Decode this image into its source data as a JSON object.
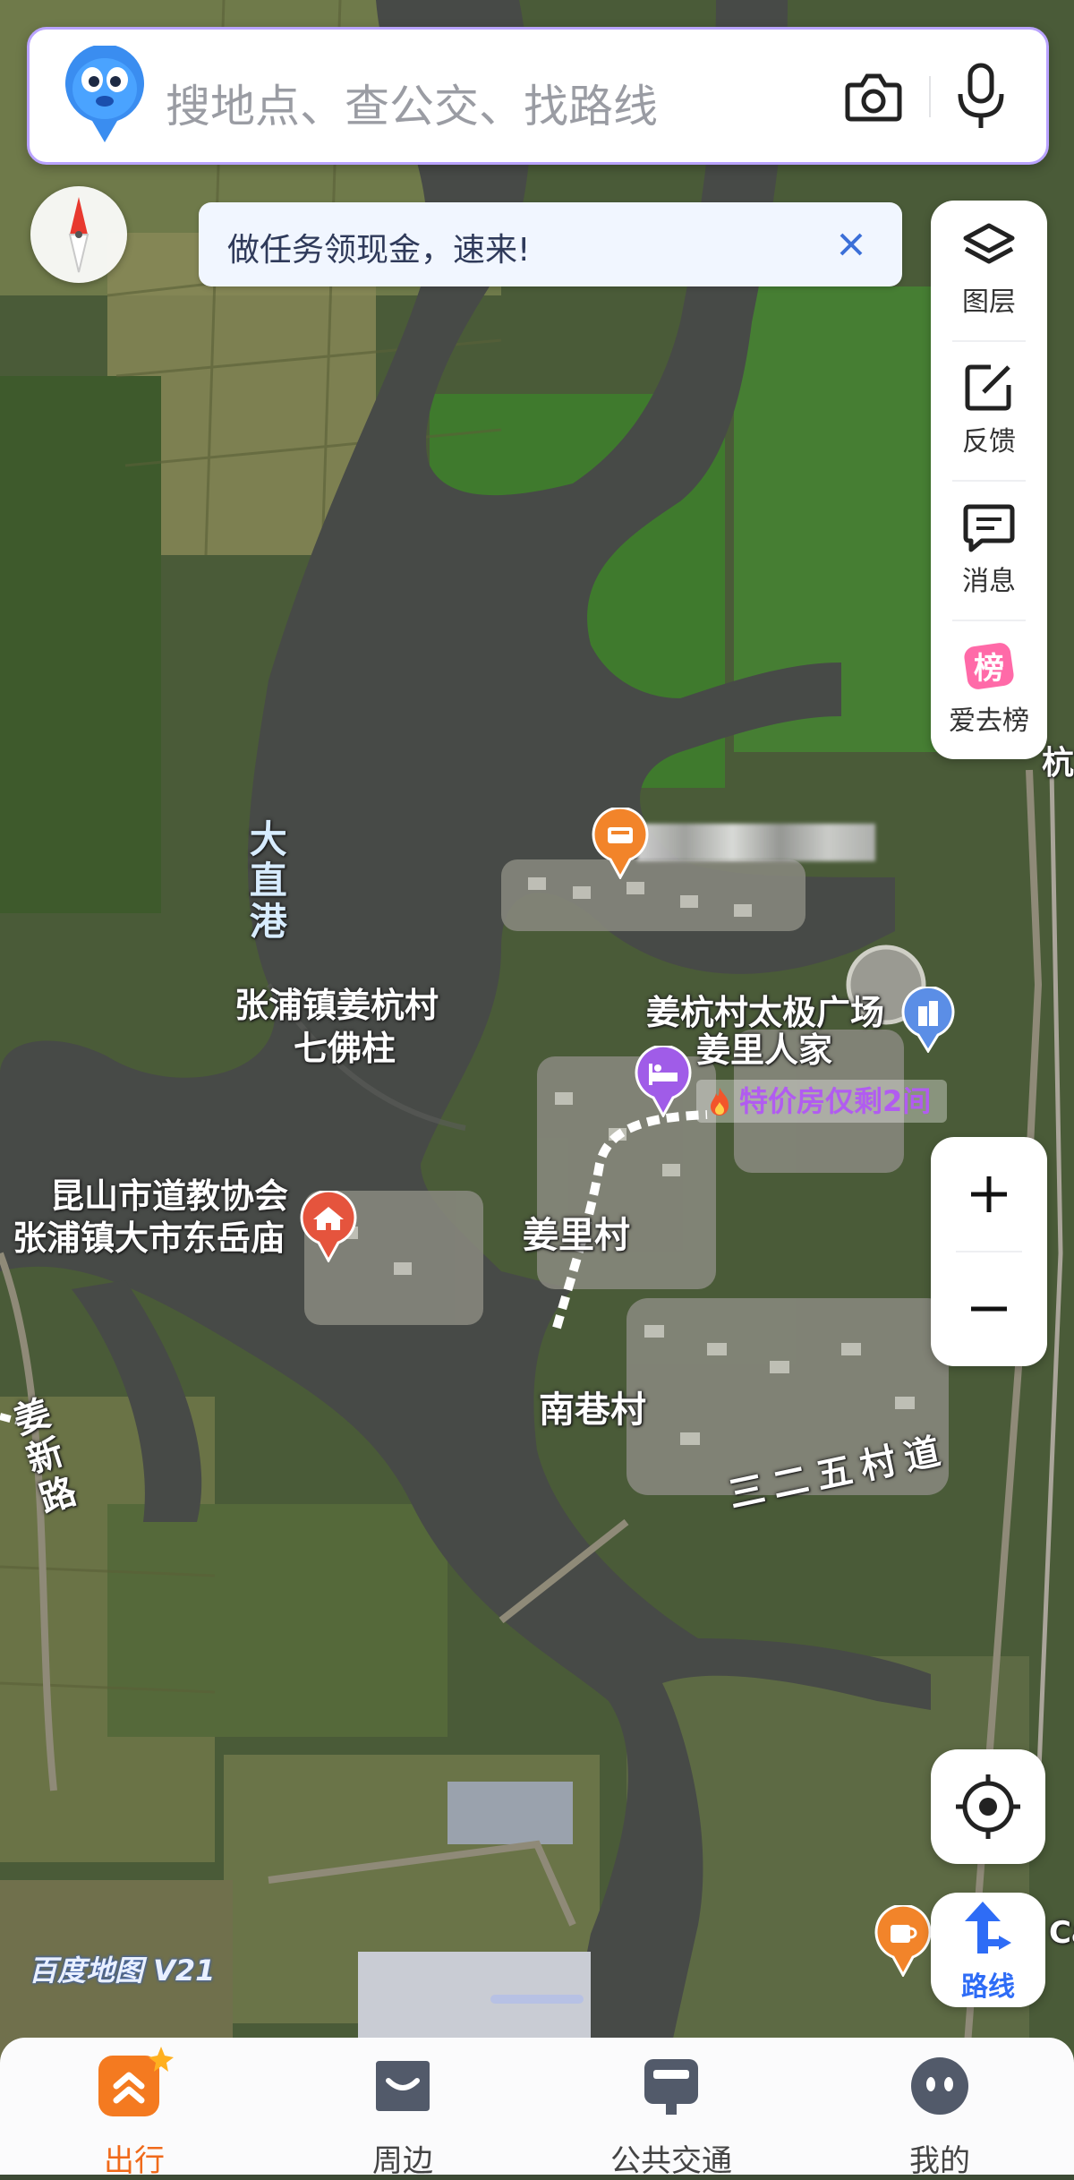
{
  "search": {
    "placeholder": "搜地点、查公交、找路线"
  },
  "banner": {
    "text": "做任务领现金，速来!"
  },
  "tools": [
    {
      "label": "图层",
      "icon": "layers-icon"
    },
    {
      "label": "反馈",
      "icon": "feedback-icon"
    },
    {
      "label": "消息",
      "icon": "message-icon"
    },
    {
      "label": "爱去榜",
      "icon": "ranking-icon"
    }
  ],
  "route": {
    "label": "路线"
  },
  "watermark": "百度地图 V21",
  "map_labels": {
    "dazhigang": "大直港",
    "zhangpu_qifozhu_line1": "张浦镇姜杭村",
    "zhangpu_qifozhu_line2": "七佛柱",
    "daojiao_line1": "昆山市道教协会",
    "daojiao_line2": "张浦镇大市东岳庙",
    "taiji_square": "姜杭村太极广场",
    "jiangli_renjia": "姜里人家",
    "hotel_deal": "特价房仅剩2间",
    "jiangli_village": "姜里村",
    "nanxiang_village": "南巷村",
    "sanerwu_road": "三二五村道",
    "jiangxin_road": "姜新路",
    "hang_partial": "杭",
    "cat_partial": "Cat"
  },
  "bottom_nav": [
    {
      "label": "出行",
      "icon": "travel-icon",
      "active": true
    },
    {
      "label": "周边",
      "icon": "nearby-icon",
      "active": false
    },
    {
      "label": "公共交通",
      "icon": "transit-icon",
      "active": false
    },
    {
      "label": "我的",
      "icon": "profile-icon",
      "active": false
    }
  ],
  "colors": {
    "accent": "#2e6cf6",
    "active_nav": "#f06a1a",
    "poi_orange": "#f2842a",
    "poi_purple": "#a05ce8",
    "poi_red": "#e5543d"
  }
}
